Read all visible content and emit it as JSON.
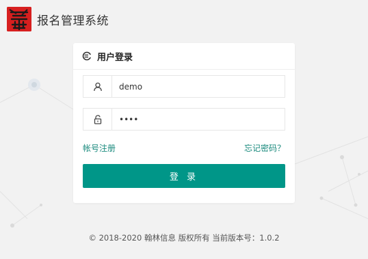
{
  "header": {
    "logo_icon": "hanlin-seal-logo",
    "app_title": "报名管理系统"
  },
  "login": {
    "title": "用户登录",
    "title_icon": "login-icon",
    "username": {
      "icon": "user-icon",
      "value": "demo"
    },
    "password": {
      "icon": "lock-icon",
      "value": "demo"
    },
    "register_link": "帐号注册",
    "forgot_link": "忘记密码？",
    "submit_label": "登 录"
  },
  "footer": {
    "copyright": "© 2018-2020 翰林信息 版权所有 当前版本号：1.0.2"
  },
  "colors": {
    "accent": "#009688",
    "link": "#1a8a7d",
    "logo_red": "#d71f1f",
    "background": "#f2f2f2"
  }
}
